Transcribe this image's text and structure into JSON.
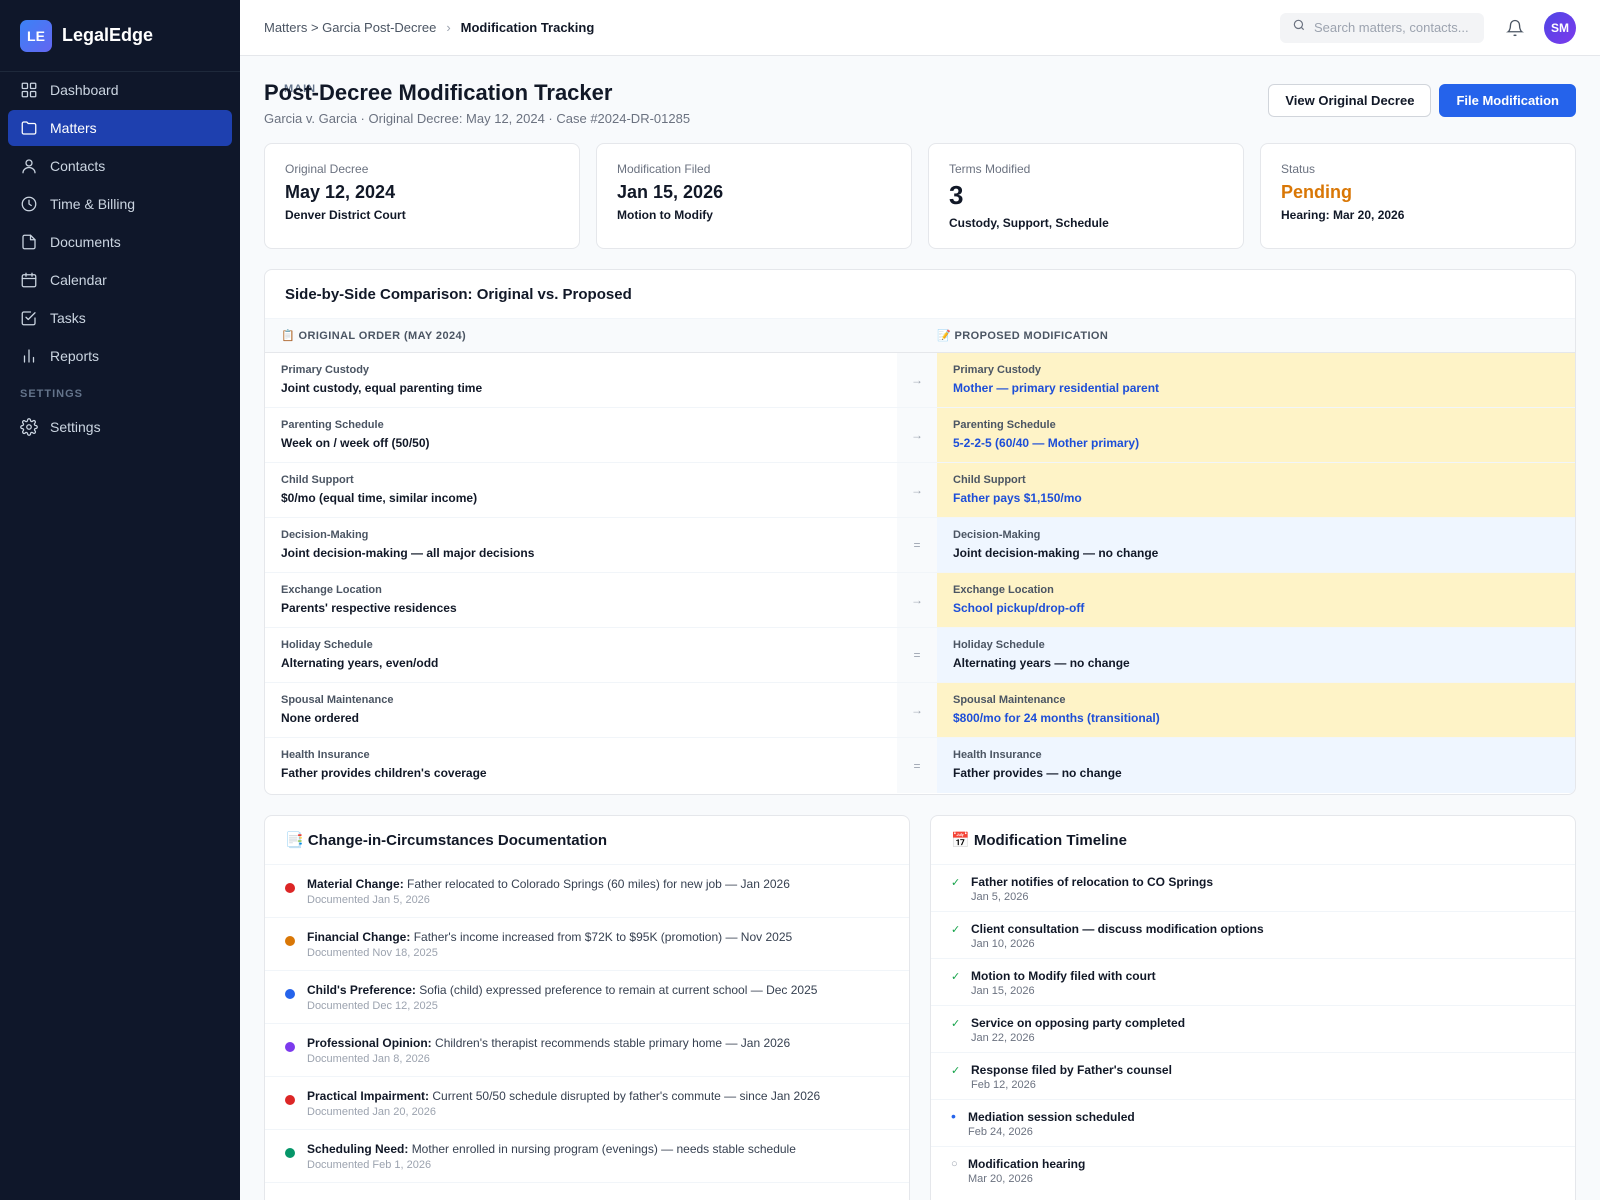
{
  "app": {
    "logo": "LE",
    "name": "LegalEdge"
  },
  "sidebar": {
    "main_label": "MAIN",
    "settings_label": "SETTINGS",
    "items": [
      {
        "label": "Dashboard",
        "icon": "dashboard-icon"
      },
      {
        "label": "Matters",
        "icon": "folder-icon",
        "active": true
      },
      {
        "label": "Contacts",
        "icon": "user-icon"
      },
      {
        "label": "Time & Billing",
        "icon": "clock-icon"
      },
      {
        "label": "Documents",
        "icon": "document-icon"
      },
      {
        "label": "Calendar",
        "icon": "calendar-icon"
      },
      {
        "label": "Tasks",
        "icon": "checkbox-icon"
      },
      {
        "label": "Reports",
        "icon": "bar-chart-icon"
      }
    ],
    "settings_items": [
      {
        "label": "Settings",
        "icon": "gear-icon"
      }
    ]
  },
  "topbar": {
    "breadcrumb": {
      "path": "Matters > Garcia Post-Decree",
      "separator": "›",
      "current": "Modification Tracking"
    },
    "search_placeholder": "Search matters, contacts...",
    "avatar": "SM"
  },
  "page": {
    "title": "Post-Decree Modification Tracker",
    "subtitle": "Garcia v. Garcia · Original Decree: May 12, 2024 · Case #2024-DR-01285",
    "view_button": "View Original Decree",
    "file_button": "File Modification"
  },
  "stats": [
    {
      "label": "Original Decree",
      "value": "May 12, 2024",
      "detail": "Denver District Court"
    },
    {
      "label": "Modification Filed",
      "value": "Jan 15, 2026",
      "detail": "Motion to Modify"
    },
    {
      "label": "Terms Modified",
      "value": "3",
      "detail": "Custody, Support, Schedule"
    },
    {
      "label": "Status",
      "value": "Pending",
      "detail": "Hearing: Mar 20, 2026",
      "color": "#d97706"
    }
  ],
  "comparison": {
    "title": "Side-by-Side Comparison: Original vs. Proposed",
    "left_header": "📋 ORIGINAL ORDER (MAY 2024)",
    "right_header": "📝 PROPOSED MODIFICATION",
    "rows": [
      {
        "label": "Primary Custody",
        "original": "Joint custody, equal parenting time",
        "marker": "→",
        "proposed": "Mother — primary residential parent",
        "changed": true
      },
      {
        "label": "Parenting Schedule",
        "original": "Week on / week off (50/50)",
        "marker": "→",
        "proposed": "5-2-2-5 (60/40 — Mother primary)",
        "changed": true
      },
      {
        "label": "Child Support",
        "original": "$0/mo (equal time, similar income)",
        "marker": "→",
        "proposed": "Father pays $1,150/mo",
        "changed": true
      },
      {
        "label": "Decision-Making",
        "original": "Joint decision-making — all major decisions",
        "marker": "=",
        "proposed": "Joint decision-making — no change",
        "changed": false
      },
      {
        "label": "Exchange Location",
        "original": "Parents' respective residences",
        "marker": "→",
        "proposed": "School pickup/drop-off",
        "changed": true
      },
      {
        "label": "Holiday Schedule",
        "original": "Alternating years, even/odd",
        "marker": "=",
        "proposed": "Alternating years — no change",
        "changed": false
      },
      {
        "label": "Spousal Maintenance",
        "original": "None ordered",
        "marker": "→",
        "proposed": "$800/mo for 24 months (transitional)",
        "changed": true
      },
      {
        "label": "Health Insurance",
        "original": "Father provides children's coverage",
        "marker": "=",
        "proposed": "Father provides — no change",
        "changed": false
      }
    ]
  },
  "circumstances": {
    "title": "📑 Change-in-Circumstances Documentation",
    "items": [
      {
        "type": "Material Change:",
        "text": "Father relocated to Colorado Springs (60 miles) for new job — Jan 2026",
        "date": "Documented Jan 5, 2026",
        "color": "#dc2626"
      },
      {
        "type": "Financial Change:",
        "text": "Father's income increased from $72K to $95K (promotion) — Nov 2025",
        "date": "Documented Nov 18, 2025",
        "color": "#d97706"
      },
      {
        "type": "Child's Preference:",
        "text": "Sofia (child) expressed preference to remain at current school — Dec 2025",
        "date": "Documented Dec 12, 2025",
        "color": "#2563eb"
      },
      {
        "type": "Professional Opinion:",
        "text": "Children's therapist recommends stable primary home — Jan 2026",
        "date": "Documented Jan 8, 2026",
        "color": "#7c3aed"
      },
      {
        "type": "Practical Impairment:",
        "text": "Current 50/50 schedule disrupted by father's commute — since Jan 2026",
        "date": "Documented Jan 20, 2026",
        "color": "#dc2626"
      },
      {
        "type": "Scheduling Need:",
        "text": "Mother enrolled in nursing program (evenings) — needs stable schedule",
        "date": "Documented Feb 1, 2026",
        "color": "#059669"
      }
    ]
  },
  "timeline": {
    "title": "📅 Modification Timeline",
    "items": [
      {
        "mark": "✓",
        "status": "done",
        "title": "Father notifies of relocation to CO Springs",
        "date": "Jan 5, 2026"
      },
      {
        "mark": "✓",
        "status": "done",
        "title": "Client consultation — discuss modification options",
        "date": "Jan 10, 2026"
      },
      {
        "mark": "✓",
        "status": "done",
        "title": "Motion to Modify filed with court",
        "date": "Jan 15, 2026"
      },
      {
        "mark": "✓",
        "status": "done",
        "title": "Service on opposing party completed",
        "date": "Jan 22, 2026"
      },
      {
        "mark": "✓",
        "status": "done",
        "title": "Response filed by Father's counsel",
        "date": "Feb 12, 2026"
      },
      {
        "mark": "•",
        "status": "current",
        "title": "Mediation session scheduled",
        "date": "Feb 24, 2026"
      },
      {
        "mark": "○",
        "status": "upcoming",
        "title": "Modification hearing",
        "date": "Mar 20, 2026"
      }
    ]
  }
}
